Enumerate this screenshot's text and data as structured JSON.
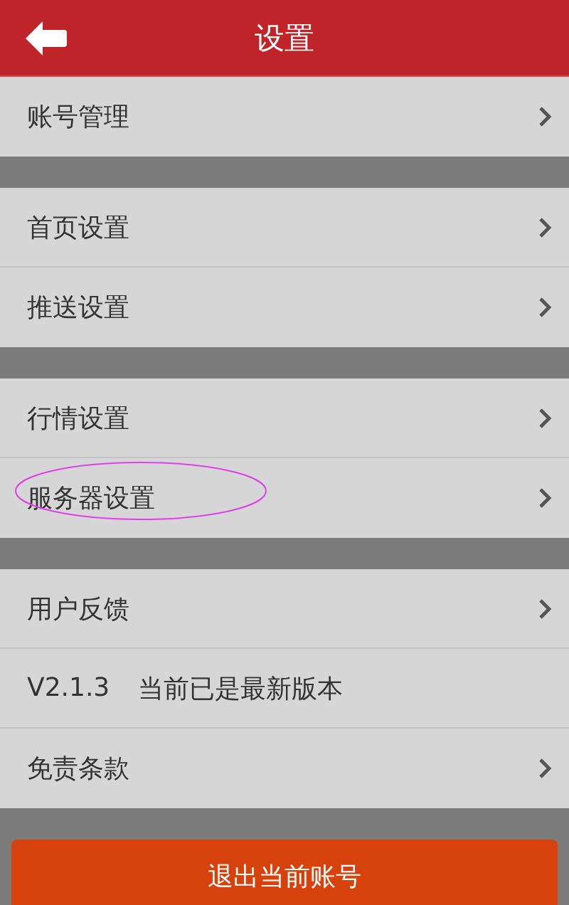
{
  "header": {
    "title": "设置"
  },
  "groups": [
    {
      "items": [
        {
          "kind": "link",
          "label": "账号管理"
        }
      ]
    },
    {
      "items": [
        {
          "kind": "link",
          "label": "首页设置"
        },
        {
          "kind": "link",
          "label": "推送设置"
        }
      ]
    },
    {
      "items": [
        {
          "kind": "link",
          "label": "行情设置"
        },
        {
          "kind": "link",
          "label": "服务器设置",
          "highlighted": true
        }
      ]
    },
    {
      "items": [
        {
          "kind": "link",
          "label": "用户反馈"
        },
        {
          "kind": "info",
          "label": "V2.1.3",
          "detail": "当前已是最新版本"
        },
        {
          "kind": "link",
          "label": "免责条款"
        }
      ]
    }
  ],
  "logout_button": "退出当前账号"
}
